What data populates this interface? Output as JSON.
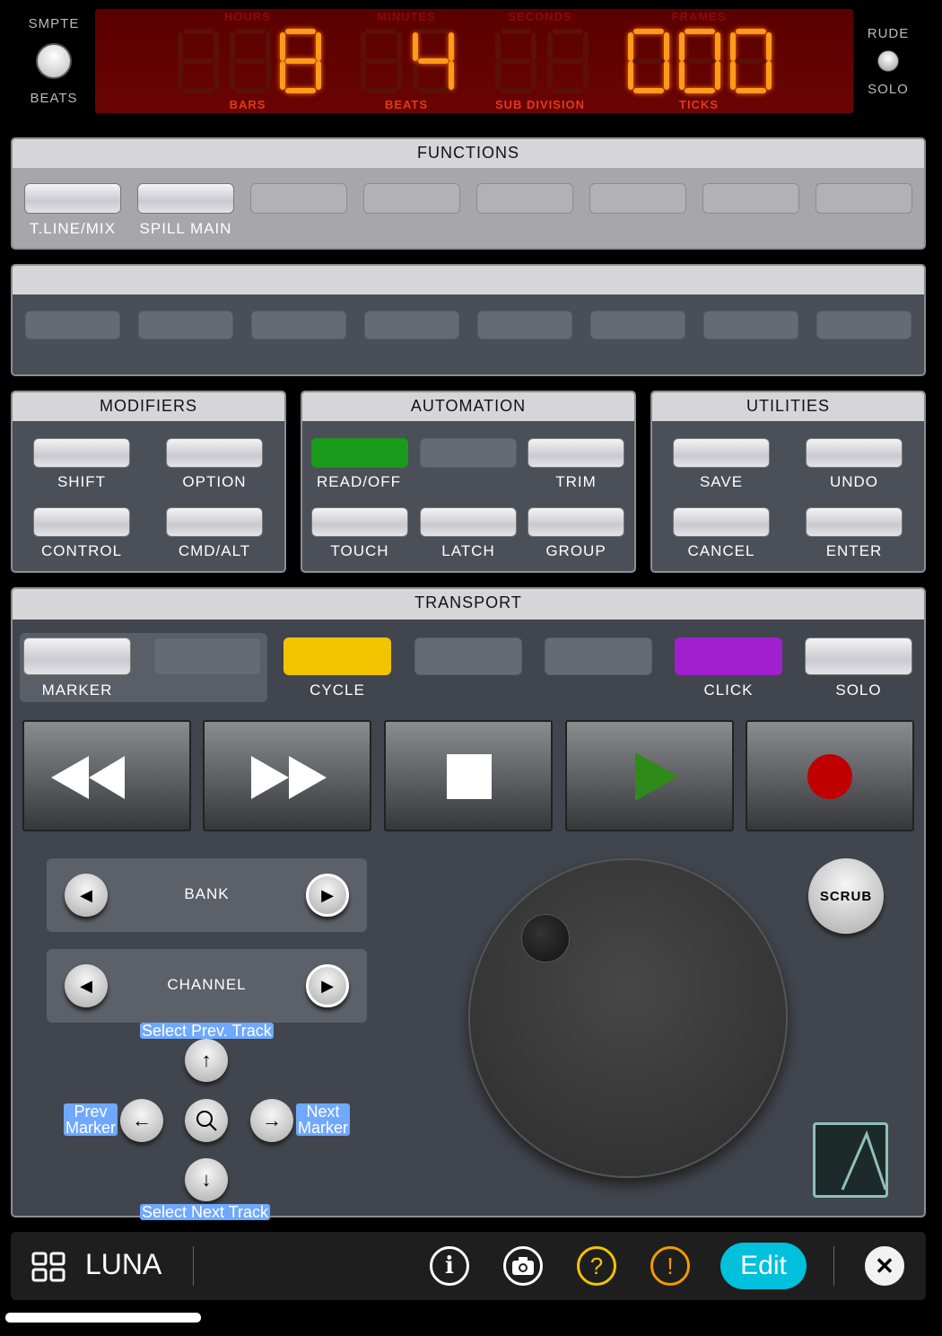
{
  "header": {
    "left_top": "SMPTE",
    "left_bottom": "BEATS",
    "right_top": "RUDE",
    "right_bottom": "SOLO",
    "display": {
      "top_labels": [
        "HOURS",
        "MINUTES",
        "SECONDS",
        "FRAMES"
      ],
      "bottom_labels": [
        "BARS",
        "BEATS",
        "SUB DIVISION",
        "TICKS"
      ],
      "groups": [
        " 8",
        " 4",
        "  ",
        "000"
      ],
      "group_sizes": [
        3,
        2,
        2,
        3
      ]
    }
  },
  "functions": {
    "title": "FUNCTIONS",
    "buttons": [
      "T.LINE/MIX",
      "SPILL MAIN",
      "",
      "",
      "",
      "",
      "",
      ""
    ]
  },
  "modifiers": {
    "title": "MODIFIERS",
    "buttons": [
      "SHIFT",
      "OPTION",
      "CONTROL",
      "CMD/ALT"
    ]
  },
  "automation": {
    "title": "AUTOMATION",
    "buttons": [
      "READ/OFF",
      "",
      "TRIM",
      "TOUCH",
      "LATCH",
      "GROUP"
    ]
  },
  "utilities": {
    "title": "UTILITIES",
    "buttons": [
      "SAVE",
      "UNDO",
      "CANCEL",
      "ENTER"
    ]
  },
  "transport": {
    "title": "TRANSPORT",
    "buttons": [
      "MARKER",
      "",
      "CYCLE",
      "",
      "",
      "CLICK",
      "SOLO"
    ],
    "colors": {
      "read": "#1a9a1a",
      "cycle": "#f2c400",
      "click": "#a020d0",
      "play": "#2f8a1a",
      "record": "#c00000"
    },
    "bank": "BANK",
    "channel": "CHANNEL",
    "scrub": "SCRUB",
    "tags": {
      "prev_track": "Select Prev. Track",
      "next_track": "Select Next Track",
      "prev_marker": "Prev Marker",
      "next_marker": "Next Marker"
    }
  },
  "toolbar": {
    "app": "LUNA",
    "edit": "Edit",
    "edit_color": "#00c0dc"
  }
}
